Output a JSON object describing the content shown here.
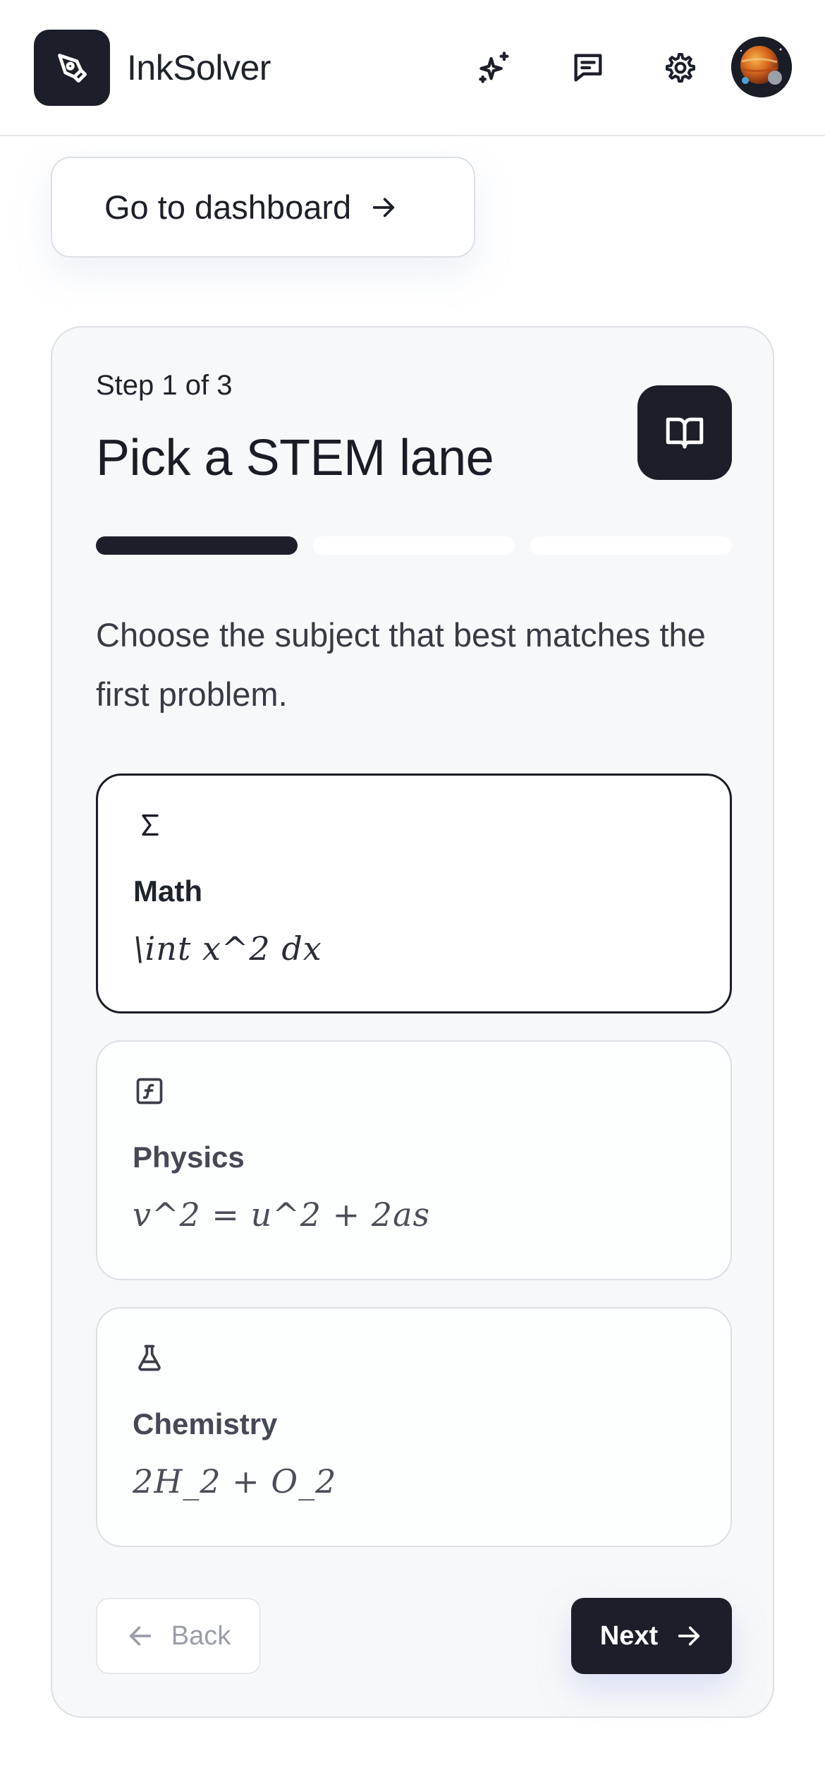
{
  "header": {
    "app_name": "InkSolver",
    "icons": [
      "pen-logo-icon",
      "sparkles-icon",
      "chat-icon",
      "gear-icon"
    ],
    "avatar": "planet-avatar"
  },
  "dashboard_button": {
    "label": "Go to dashboard"
  },
  "wizard": {
    "step_label": "Step 1 of 3",
    "title": "Pick a STEM lane",
    "progress": {
      "current_step": 1,
      "total_steps": 3
    },
    "subtitle": "Choose the subject that best matches the first problem.",
    "options": [
      {
        "label": "Math",
        "example": "\\int x^2 dx",
        "icon": "sigma-icon",
        "selected": true
      },
      {
        "label": "Physics",
        "example": "v^2 = u^2 + 2as",
        "icon": "function-icon",
        "selected": false
      },
      {
        "label": "Chemistry",
        "example": "2H_2 + O_2",
        "icon": "flask-icon",
        "selected": false
      }
    ],
    "back_label": "Back",
    "next_label": "Next"
  },
  "colors": {
    "primary_dark": "#1c1f2a",
    "card_bg": "#f7f8fa",
    "border": "#dcdfe4",
    "muted_text": "#9a9ea8"
  }
}
